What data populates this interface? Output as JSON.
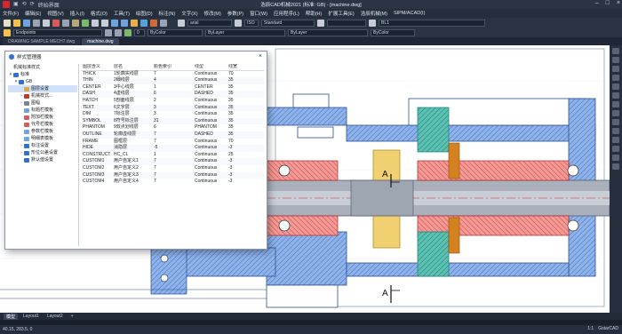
{
  "window": {
    "title": "浩辰CAD机械2021 (标准: GB) - [machine.dwg]",
    "quick_access": [
      "▣",
      "⟲",
      "⟳",
      "终始界面"
    ]
  },
  "menu": [
    "文件(F)",
    "编辑(E)",
    "视图(V)",
    "插入(I)",
    "格式(O)",
    "工具(T)",
    "绘图(D)",
    "标注(N)",
    "文字(X)",
    "修改(M)",
    "参数(P)",
    "窗口(W)",
    "应用程序(L)",
    "帮助(H)",
    "扩展工具(E)",
    "浩辰机械(M)",
    "SIPM/ACAD(I)"
  ],
  "toolbar": {
    "workspace": "Endpoints",
    "text_style": "arial",
    "dim_style": "Standard",
    "layer_value": "0",
    "layer_right": "BL1",
    "linetype": "ByLayer",
    "lineweight": "ByLayer",
    "color": "ByColor"
  },
  "doc_tabs": [
    "DRAWING SAMPLE MECH7.dwg",
    "machine.dwg"
  ],
  "layout_tabs": [
    "模型",
    "Layout1",
    "Layout2",
    "+"
  ],
  "status": {
    "coords": "40.15, 283.5, 0",
    "zoom": "1:1",
    "brand": "GstarCAD"
  },
  "dialog": {
    "title": "样式管理器",
    "tree": [
      {
        "label": "机械标准样式",
        "level": 0,
        "exp": ""
      },
      {
        "label": "标准",
        "level": 0,
        "exp": "▾"
      },
      {
        "label": "GB",
        "level": 1,
        "exp": "▾"
      },
      {
        "label": "图层设置",
        "level": 2,
        "exp": "",
        "selected": true
      },
      {
        "label": "机械样式...",
        "level": 2,
        "exp": "›"
      },
      {
        "label": "图幅",
        "level": 2,
        "exp": "›"
      },
      {
        "label": "标题栏模板",
        "level": 2,
        "exp": ""
      },
      {
        "label": "附加栏模板",
        "level": 2,
        "exp": ""
      },
      {
        "label": "代号栏模板",
        "level": 2,
        "exp": ""
      },
      {
        "label": "参数栏模板",
        "level": 2,
        "exp": ""
      },
      {
        "label": "明细表模板",
        "level": 2,
        "exp": ""
      },
      {
        "label": "标注设置",
        "level": 2,
        "exp": "›"
      },
      {
        "label": "形位公差设置",
        "level": 2,
        "exp": "›"
      },
      {
        "label": "默认值设置",
        "level": 2,
        "exp": ""
      }
    ],
    "columns": [
      "图层含义",
      "层名",
      "颜色索引",
      "线型",
      "线宽"
    ],
    "rows": [
      [
        "THICK",
        "1轮廓实线层",
        "7",
        "Continuous",
        "70"
      ],
      [
        "THIN",
        "2细线层",
        "4",
        "Continuous",
        "35"
      ],
      [
        "CENTER",
        "3中心线层",
        "1",
        "CENTER",
        "35"
      ],
      [
        "DASH",
        "4虚线层",
        "6",
        "DASHED",
        "35"
      ],
      [
        "HATCH",
        "5剖面线层",
        "2",
        "Continuous",
        "35"
      ],
      [
        "TEXT",
        "6文字层",
        "3",
        "Continuous",
        "35"
      ],
      [
        "DIM",
        "7标注层",
        "3",
        "Continuous",
        "35"
      ],
      [
        "SYMBOL",
        "8符号标注层",
        "31",
        "Continuous",
        "35"
      ],
      [
        "PHANTOM",
        "9双点划线层",
        "6",
        "PHANTOM",
        "35"
      ],
      [
        "OUTLINE",
        "轮廓虚线层",
        "7",
        "DASHED",
        "35"
      ],
      [
        "FRAME",
        "图框层",
        "7",
        "Continuous",
        "70"
      ],
      [
        "HIDE",
        "消隐层",
        "-5",
        "Continuous",
        "-3"
      ],
      [
        "CONSTRUCT",
        "HC_CL",
        "1",
        "Continuous",
        "25"
      ],
      [
        "CUSTOM1",
        "用户自定义1",
        "7",
        "Continuous",
        "-3"
      ],
      [
        "CUSTOM2",
        "用户自定义2",
        "7",
        "Continuous",
        "-3"
      ],
      [
        "CUSTOM3",
        "用户自定义3",
        "7",
        "Continuous",
        "-3"
      ],
      [
        "CUSTOM4",
        "用户自定义4",
        "7",
        "Continuous",
        "-3"
      ]
    ]
  },
  "drawing": {
    "section_label_top": "A",
    "section_label_bottom": "A"
  },
  "colors": {
    "hatch_blue": "#5a8bd8",
    "bearing_red": "#e35b56",
    "gear_teal": "#2ea394",
    "gear_orange": "#d4821f",
    "gear_yellow": "#f0d070",
    "shaft_gray": "#a8aeb8"
  }
}
